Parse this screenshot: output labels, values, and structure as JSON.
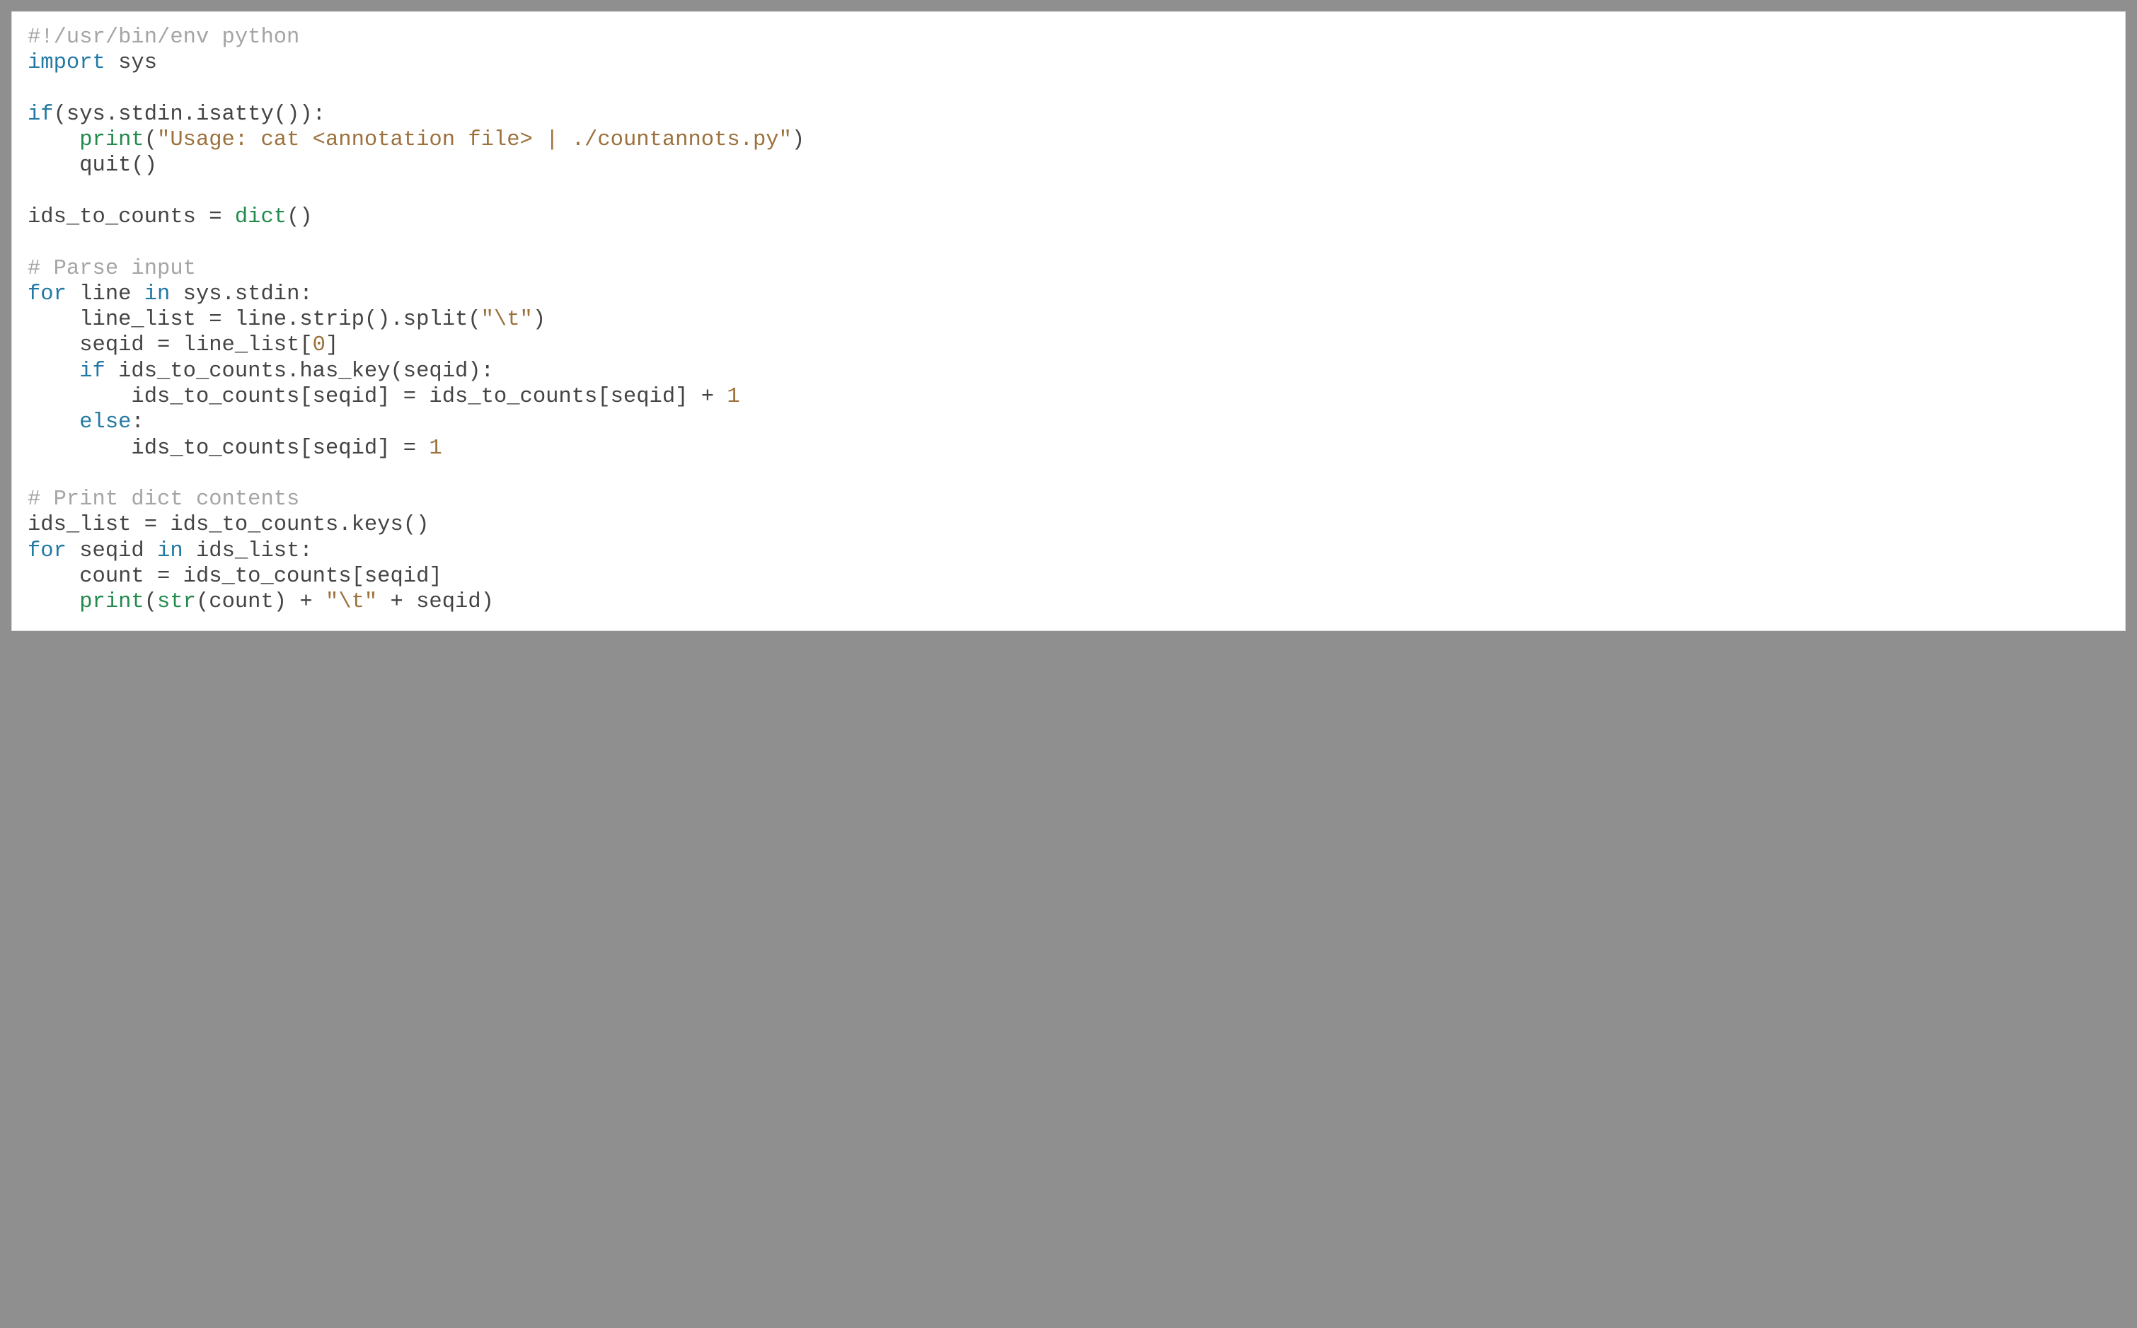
{
  "code": {
    "language": "python",
    "lines": [
      [
        {
          "cls": "c",
          "text": "#!/usr/bin/env python"
        }
      ],
      [
        {
          "cls": "k",
          "text": "import"
        },
        {
          "cls": "t",
          "text": " sys"
        }
      ],
      [
        {
          "cls": "t",
          "text": ""
        }
      ],
      [
        {
          "cls": "k",
          "text": "if"
        },
        {
          "cls": "t",
          "text": "(sys.stdin.isatty()):"
        }
      ],
      [
        {
          "cls": "t",
          "text": "    "
        },
        {
          "cls": "b",
          "text": "print"
        },
        {
          "cls": "t",
          "text": "("
        },
        {
          "cls": "s",
          "text": "\"Usage: cat <annotation file> | ./countannots.py\""
        },
        {
          "cls": "t",
          "text": ")"
        }
      ],
      [
        {
          "cls": "t",
          "text": "    quit()"
        }
      ],
      [
        {
          "cls": "t",
          "text": ""
        }
      ],
      [
        {
          "cls": "t",
          "text": "ids_to_counts = "
        },
        {
          "cls": "b",
          "text": "dict"
        },
        {
          "cls": "t",
          "text": "()"
        }
      ],
      [
        {
          "cls": "t",
          "text": ""
        }
      ],
      [
        {
          "cls": "c",
          "text": "# Parse input"
        }
      ],
      [
        {
          "cls": "k",
          "text": "for"
        },
        {
          "cls": "t",
          "text": " line "
        },
        {
          "cls": "k",
          "text": "in"
        },
        {
          "cls": "t",
          "text": " sys.stdin:"
        }
      ],
      [
        {
          "cls": "t",
          "text": "    line_list = line.strip().split("
        },
        {
          "cls": "s",
          "text": "\"\\t\""
        },
        {
          "cls": "t",
          "text": ")"
        }
      ],
      [
        {
          "cls": "t",
          "text": "    seqid = line_list["
        },
        {
          "cls": "n",
          "text": "0"
        },
        {
          "cls": "t",
          "text": "]"
        }
      ],
      [
        {
          "cls": "t",
          "text": "    "
        },
        {
          "cls": "k",
          "text": "if"
        },
        {
          "cls": "t",
          "text": " ids_to_counts.has_key(seqid):"
        }
      ],
      [
        {
          "cls": "t",
          "text": "        ids_to_counts[seqid] = ids_to_counts[seqid] + "
        },
        {
          "cls": "n",
          "text": "1"
        }
      ],
      [
        {
          "cls": "t",
          "text": "    "
        },
        {
          "cls": "k",
          "text": "else"
        },
        {
          "cls": "t",
          "text": ":"
        }
      ],
      [
        {
          "cls": "t",
          "text": "        ids_to_counts[seqid] = "
        },
        {
          "cls": "n",
          "text": "1"
        }
      ],
      [
        {
          "cls": "t",
          "text": ""
        }
      ],
      [
        {
          "cls": "c",
          "text": "# Print dict contents"
        }
      ],
      [
        {
          "cls": "t",
          "text": "ids_list = ids_to_counts.keys()"
        }
      ],
      [
        {
          "cls": "k",
          "text": "for"
        },
        {
          "cls": "t",
          "text": " seqid "
        },
        {
          "cls": "k",
          "text": "in"
        },
        {
          "cls": "t",
          "text": " ids_list:"
        }
      ],
      [
        {
          "cls": "t",
          "text": "    count = ids_to_counts[seqid]"
        }
      ],
      [
        {
          "cls": "t",
          "text": "    "
        },
        {
          "cls": "b",
          "text": "print"
        },
        {
          "cls": "t",
          "text": "("
        },
        {
          "cls": "b",
          "text": "str"
        },
        {
          "cls": "t",
          "text": "(count) + "
        },
        {
          "cls": "s",
          "text": "\"\\t\""
        },
        {
          "cls": "t",
          "text": " + seqid)"
        }
      ]
    ]
  }
}
